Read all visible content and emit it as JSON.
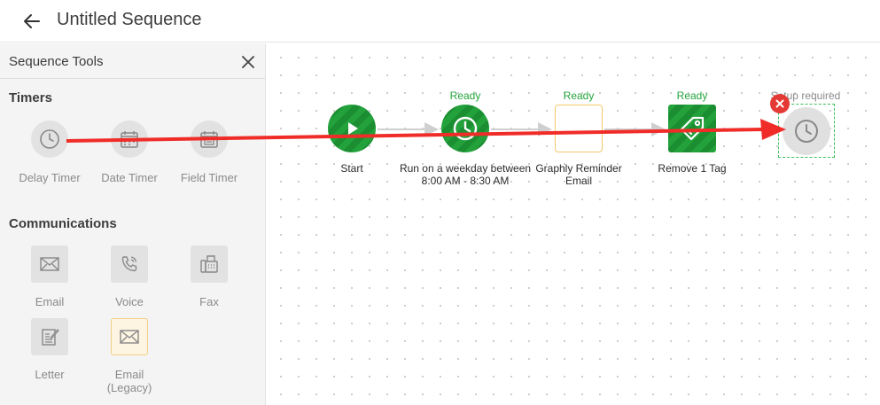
{
  "header": {
    "title": "Untitled Sequence",
    "back_icon": "arrow-left-icon"
  },
  "sidebar": {
    "title": "Sequence Tools",
    "close_icon": "close-icon",
    "sections": {
      "timers": {
        "title": "Timers",
        "items": [
          {
            "label": "Delay Timer",
            "icon": "clock-icon"
          },
          {
            "label": "Date Timer",
            "icon": "calendar-icon"
          },
          {
            "label": "Field Timer",
            "icon": "calendar-field-icon"
          }
        ]
      },
      "communications": {
        "title": "Communications",
        "items": [
          {
            "label": "Email",
            "icon": "envelope-icon"
          },
          {
            "label": "Voice",
            "icon": "phone-icon"
          },
          {
            "label": "Fax",
            "icon": "fax-icon"
          },
          {
            "label": "Letter",
            "icon": "letter-icon"
          },
          {
            "label_line1": "Email",
            "label_line2": "(Legacy)",
            "icon": "envelope-icon"
          }
        ]
      }
    }
  },
  "canvas": {
    "nodes": [
      {
        "label": "Start",
        "status": "",
        "icon": "play-icon"
      },
      {
        "label_line1": "Run on a weekday between",
        "label_line2": "8:00 AM - 8:30 AM",
        "status": "Ready",
        "icon": "clock-icon"
      },
      {
        "label_line1": "Graphly Reminder",
        "label_line2": "Email",
        "status": "Ready",
        "icon": ""
      },
      {
        "label": "Remove 1 Tag",
        "status": "Ready",
        "icon": "tag-icon"
      },
      {
        "label": "",
        "status": "Setup required",
        "icon": "clock-icon",
        "error_icon": "close-icon"
      }
    ]
  },
  "colors": {
    "ready": "#23a53b",
    "error": "#e53935",
    "annotation_arrow": "#f02c28",
    "connector": "#cfcfcf"
  }
}
